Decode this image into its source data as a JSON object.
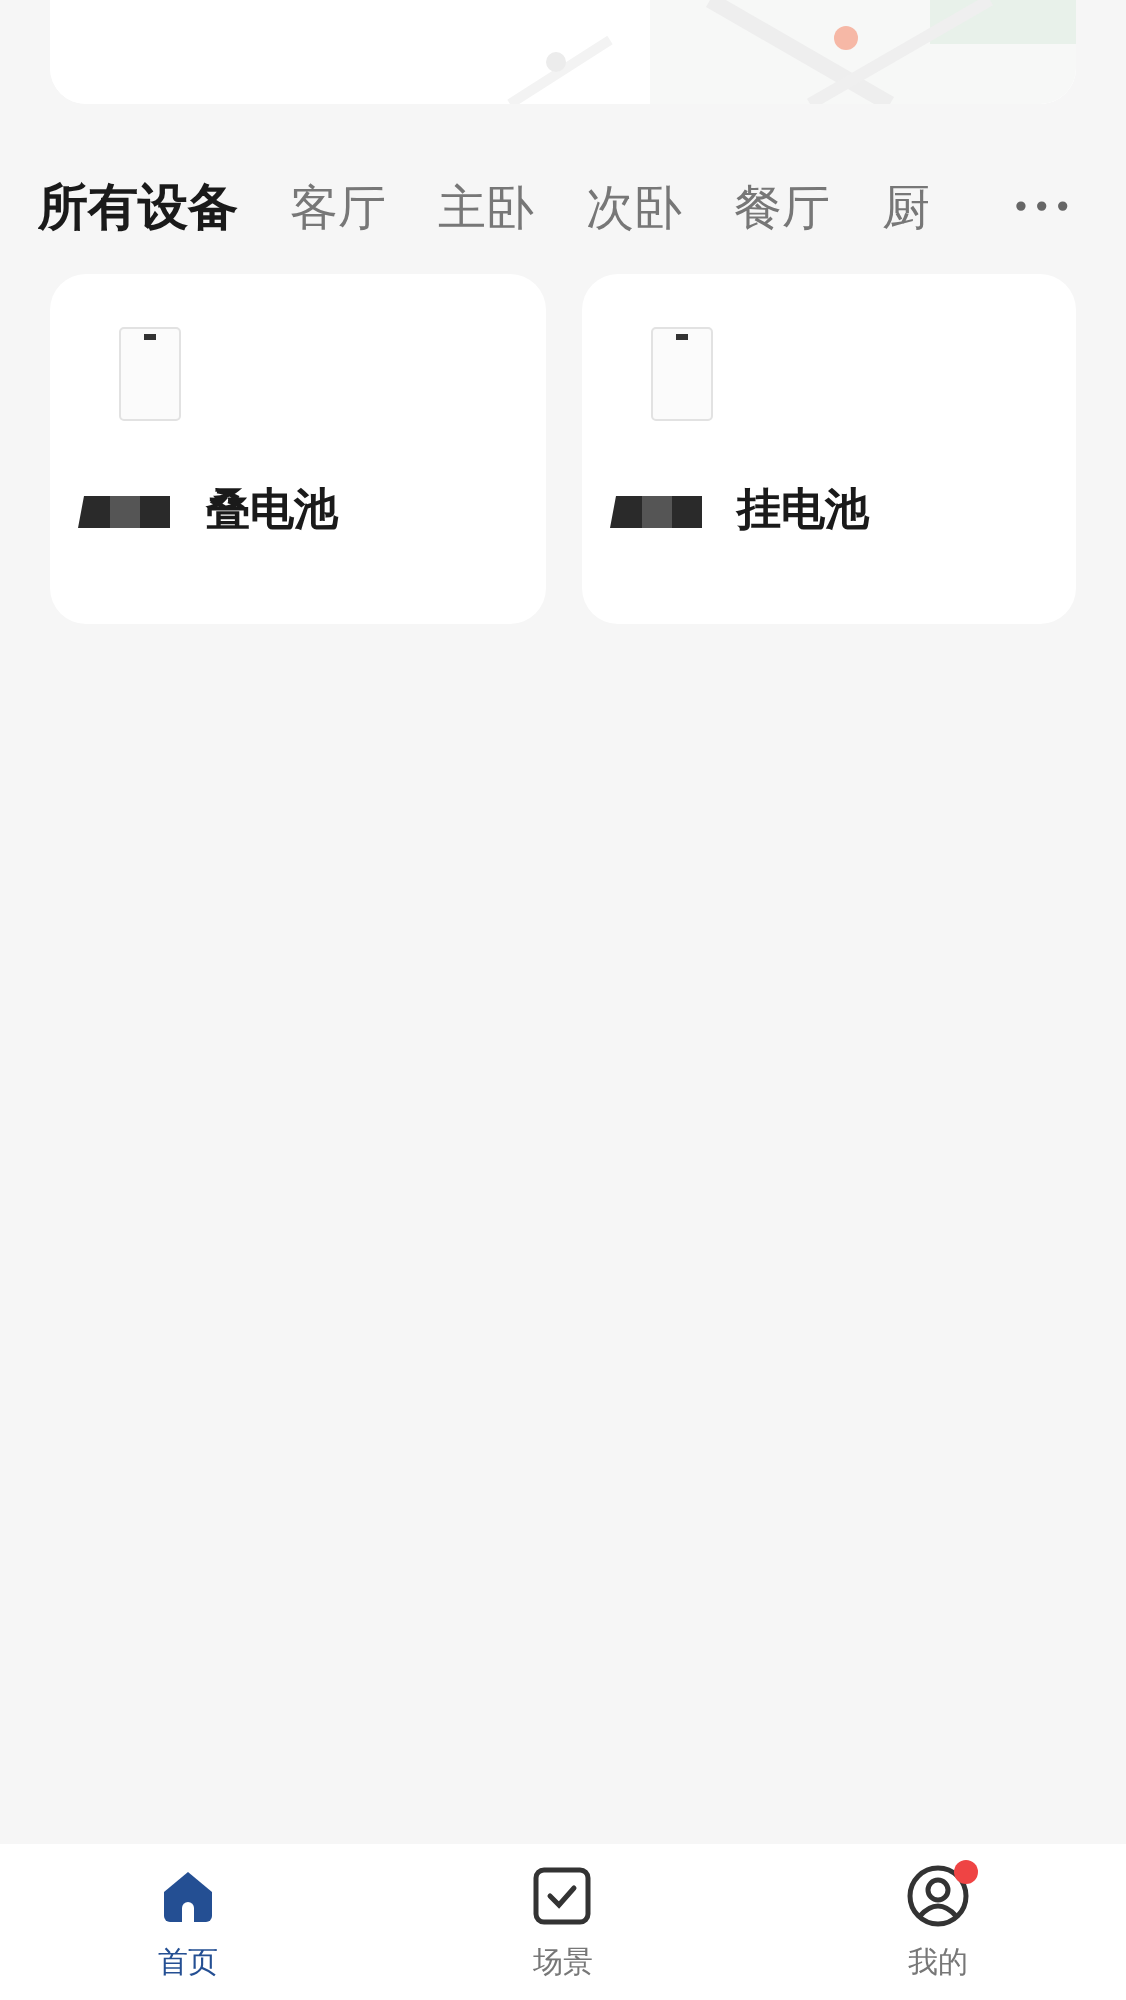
{
  "room_tabs": [
    {
      "label": "所有设备",
      "selected": true
    },
    {
      "label": "客厅",
      "selected": false
    },
    {
      "label": "主卧",
      "selected": false
    },
    {
      "label": "次卧",
      "selected": false
    },
    {
      "label": "餐厅",
      "selected": false
    },
    {
      "label": "厨",
      "selected": false
    }
  ],
  "more": "•••",
  "devices": [
    {
      "name": "叠电池"
    },
    {
      "name": "挂电池"
    }
  ],
  "nav": [
    {
      "label": "首页",
      "kind": "home",
      "selected": true,
      "badge": false
    },
    {
      "label": "场景",
      "kind": "scene",
      "selected": false,
      "badge": false
    },
    {
      "label": "我的",
      "kind": "me",
      "selected": false,
      "badge": true
    }
  ]
}
